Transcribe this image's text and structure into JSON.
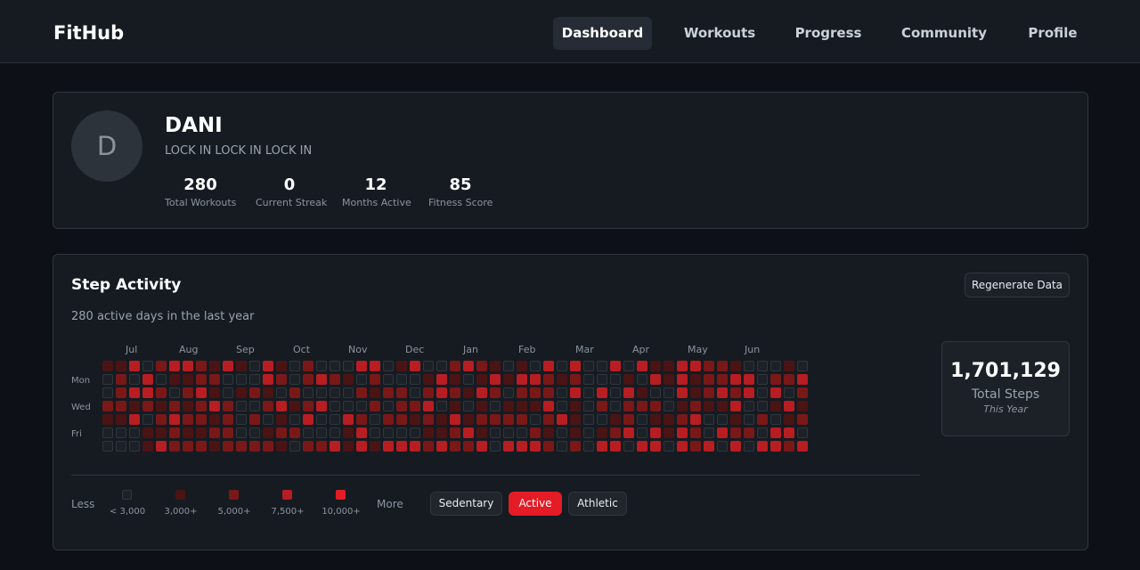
{
  "app": {
    "brand": "FitHub"
  },
  "nav": [
    {
      "label": "Dashboard",
      "active": true
    },
    {
      "label": "Workouts",
      "active": false
    },
    {
      "label": "Progress",
      "active": false
    },
    {
      "label": "Community",
      "active": false
    },
    {
      "label": "Profile",
      "active": false
    }
  ],
  "profile": {
    "avatar_initial": "D",
    "name": "DANI",
    "bio": "LOCK IN LOCK IN LOCK IN",
    "stats": [
      {
        "value": "280",
        "label": "Total Workouts"
      },
      {
        "value": "0",
        "label": "Current Streak"
      },
      {
        "value": "12",
        "label": "Months Active"
      },
      {
        "value": "85",
        "label": "Fitness Score"
      }
    ]
  },
  "activity": {
    "title": "Step Activity",
    "subtitle": "280 active days in the last year",
    "regenerate_label": "Regenerate Data",
    "months": [
      "Jul",
      "Aug",
      "Sep",
      "Oct",
      "Nov",
      "Dec",
      "Jan",
      "Feb",
      "Mar",
      "Apr",
      "May",
      "Jun"
    ],
    "day_labels": [
      "Mon",
      "Wed",
      "Fri"
    ],
    "weeks": 53,
    "days_per_week": 7,
    "levels": [
      1,
      0,
      0,
      2,
      1,
      0,
      0,
      1,
      2,
      2,
      2,
      1,
      0,
      0,
      3,
      0,
      3,
      1,
      3,
      0,
      0,
      0,
      3,
      3,
      2,
      0,
      1,
      1,
      2,
      0,
      2,
      1,
      2,
      1,
      3,
      3,
      1,
      0,
      2,
      3,
      2,
      2,
      3,
      1,
      2,
      1,
      2,
      1,
      2,
      2,
      2,
      3,
      2,
      2,
      1,
      2,
      1,
      2,
      1,
      3,
      1,
      2,
      1,
      3,
      0,
      0,
      2,
      2,
      2,
      2,
      1,
      0,
      1,
      0,
      0,
      0,
      2,
      0,
      0,
      2,
      0,
      2,
      0,
      2,
      3,
      3,
      1,
      2,
      0,
      1,
      2,
      1,
      2,
      0,
      3,
      1,
      2,
      1,
      0,
      0,
      2,
      1,
      0,
      2,
      0,
      2,
      2,
      0,
      2,
      3,
      0,
      2,
      0,
      3,
      0,
      3,
      0,
      0,
      2,
      0,
      2,
      0,
      0,
      0,
      0,
      3,
      0,
      1,
      0,
      0,
      3,
      1,
      1,
      3,
      0,
      2,
      0,
      2,
      3,
      3,
      3,
      2,
      1,
      2,
      0,
      0,
      1,
      0,
      0,
      2,
      0,
      2,
      0,
      3,
      1,
      0,
      2,
      2,
      2,
      0,
      3,
      3,
      0,
      0,
      2,
      1,
      0,
      3,
      0,
      1,
      2,
      3,
      2,
      1,
      2,
      0,
      3,
      3,
      0,
      1,
      1,
      3,
      2,
      1,
      2,
      1,
      3,
      2,
      2,
      3,
      0,
      1,
      0,
      1,
      3,
      2,
      2,
      1,
      3,
      1,
      2,
      1,
      3,
      1,
      3,
      2,
      0,
      2,
      0,
      0,
      0,
      1,
      0,
      1,
      2,
      0,
      3,
      1,
      3,
      2,
      1,
      2,
      0,
      3,
      0,
      3,
      2,
      1,
      0,
      2,
      3,
      3,
      2,
      2,
      3,
      2,
      1,
      2,
      0,
      1,
      0,
      0,
      3,
      0,
      0,
      3,
      2,
      3,
      1,
      1,
      1,
      2,
      0,
      0,
      0,
      0,
      0,
      0,
      0,
      0,
      0,
      3,
      2,
      0,
      1,
      3,
      3,
      0,
      0,
      0,
      1,
      2,
      3,
      0,
      1,
      3,
      2,
      2,
      3,
      0,
      3,
      0,
      1,
      2,
      0,
      0,
      3,
      1,
      3,
      0,
      2,
      1,
      3,
      3,
      1,
      1,
      0,
      0,
      1,
      1,
      0,
      3,
      3,
      3,
      1,
      2,
      3,
      3,
      3,
      1,
      1,
      2,
      3,
      2,
      2,
      2,
      2,
      2,
      1,
      0,
      0,
      3,
      2,
      2,
      3,
      1,
      0,
      3,
      0,
      1,
      3,
      2,
      3,
      1,
      2,
      3,
      0,
      3,
      3,
      0,
      0,
      2,
      0,
      0,
      0,
      0,
      0,
      2,
      0,
      3,
      0,
      2,
      3,
      1,
      0,
      3,
      3,
      1,
      2,
      0,
      3,
      1,
      3,
      2,
      0,
      3,
      2,
      1,
      2,
      0,
      3
    ],
    "legend": {
      "less_label": "Less",
      "more_label": "More",
      "items": [
        {
          "label": "< 3,000",
          "color": "#1c2128"
        },
        {
          "label": "3,000+",
          "color": "#4a1414"
        },
        {
          "label": "5,000+",
          "color": "#7a1818"
        },
        {
          "label": "7,500+",
          "color": "#b81d22"
        },
        {
          "label": "10,000+",
          "color": "#e31c25"
        }
      ]
    },
    "filters": [
      {
        "label": "Sedentary",
        "active": false
      },
      {
        "label": "Active",
        "active": true
      },
      {
        "label": "Athletic",
        "active": false
      }
    ],
    "total": {
      "value": "1,701,129",
      "label": "Total Steps",
      "sublabel": "This Year"
    }
  }
}
